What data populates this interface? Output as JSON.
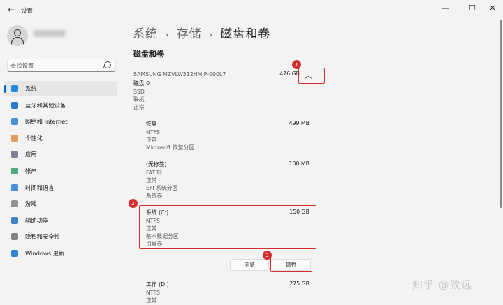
{
  "window": {
    "title": "设置",
    "back_icon": "back-arrow-icon",
    "minimize_glyph": "—",
    "maximize_glyph": "☐",
    "close_glyph": "✕"
  },
  "sidebar": {
    "search_placeholder": "查找设置",
    "items": [
      {
        "label": "系统",
        "icon": "monitor-icon",
        "color": "#0078d4",
        "active": true
      },
      {
        "label": "蓝牙和其他设备",
        "icon": "bluetooth-icon",
        "color": "#0067c0"
      },
      {
        "label": "网络和 Internet",
        "icon": "wifi-icon",
        "color": "#2b7cd3"
      },
      {
        "label": "个性化",
        "icon": "brush-icon",
        "color": "#d98d3b"
      },
      {
        "label": "应用",
        "icon": "apps-icon",
        "color": "#6c6c8a"
      },
      {
        "label": "帐户",
        "icon": "person-icon",
        "color": "#2e9e6a"
      },
      {
        "label": "时间和语言",
        "icon": "globe-clock-icon",
        "color": "#2b7cd3"
      },
      {
        "label": "游戏",
        "icon": "gamepad-icon",
        "color": "#808080"
      },
      {
        "label": "辅助功能",
        "icon": "accessibility-icon",
        "color": "#1f6fbf"
      },
      {
        "label": "隐私和安全性",
        "icon": "shield-icon",
        "color": "#6d6d6d"
      },
      {
        "label": "Windows 更新",
        "icon": "update-icon",
        "color": "#0a6fd1"
      }
    ]
  },
  "breadcrumb": {
    "items": [
      "系统",
      "存储",
      "磁盘和卷"
    ],
    "separator": "›"
  },
  "section_title": "磁盘和卷",
  "disk": {
    "model": "SAMSUNG MZVLW512HMJP-000L7",
    "size": "476 GB",
    "name": "磁盘 0",
    "type": "SSD",
    "state": "联机",
    "health": "正常"
  },
  "volumes": [
    {
      "name": "恢复",
      "size": "499 MB",
      "lines": [
        "NTFS",
        "正常",
        "Microsoft 恢复分区"
      ]
    },
    {
      "name": "(无标签)",
      "size": "100 MB",
      "lines": [
        "FAT32",
        "正常",
        "EFI 系统分区",
        "系统卷"
      ]
    },
    {
      "name": "系统 (C:)",
      "size": "150 GB",
      "lines": [
        "NTFS",
        "正常",
        "基本数据分区",
        "引导卷"
      ]
    },
    {
      "name": "工作 (D:)",
      "size": "275 GB",
      "lines": [
        "NTFS",
        "正常"
      ]
    }
  ],
  "actions": {
    "browse": "浏览",
    "properties": "属性"
  },
  "annotations": {
    "badge1": "1",
    "badge2": "2",
    "badge3": "3",
    "color": "#d62e2e"
  },
  "watermark": "知乎 @致远"
}
